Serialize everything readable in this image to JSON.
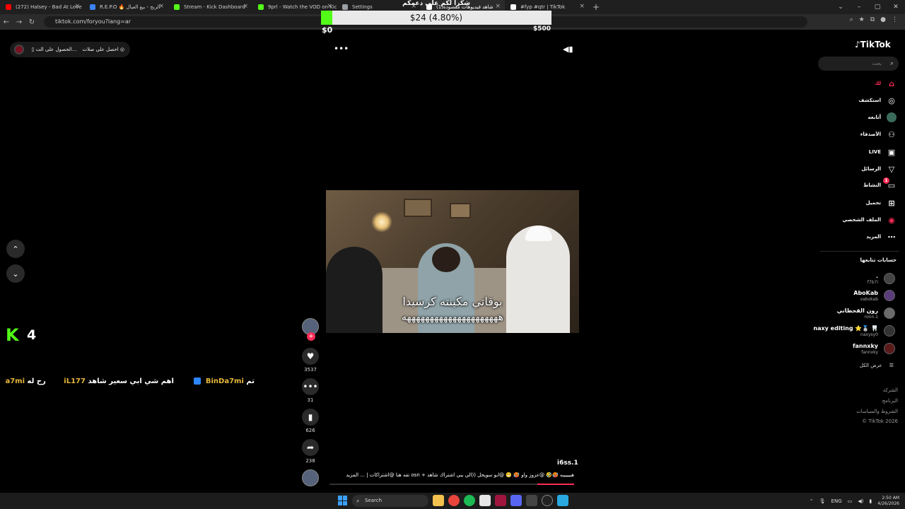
{
  "browser": {
    "tabs": [
      {
        "title": "(272) Halsey - Bad At Love",
        "favicon_color": "#ff0000"
      },
      {
        "title": "R.E.P.O 🔥 الربح - بيع العيال",
        "favicon_color": "#3b82f6"
      },
      {
        "title": "Stream - Kick Dashboard",
        "favicon_color": "#53fc18"
      },
      {
        "title": "9prl - Watch the VOD on Kick",
        "favicon_color": "#53fc18"
      },
      {
        "title": "Settings",
        "favicon_color": "#9aa0a6"
      },
      {
        "title": "(1)شاهد فيديوهات مقصودة",
        "favicon_color": "#ffffff"
      },
      {
        "title": "#fyp #qtr | TikTok",
        "favicon_color": "#ffffff"
      }
    ],
    "active_tab_index": 5,
    "url": "tiktok.com/foryou?lang=ar"
  },
  "donation": {
    "header": "شكرا لكم على دعمكم",
    "amount_text": "$24 (4.80%)",
    "progress_fraction": 0.048,
    "min_label": "$0",
    "max_label": "$500",
    "fill_color": "#53fc18"
  },
  "promo": {
    "item1": "احصل على صلات",
    "item2": "الحصول على الت..."
  },
  "video": {
    "subtitle_line1": "بوقاتي مكينته كرسيدا",
    "subtitle_line2": "هههههههههههههههههههههه"
  },
  "actions": {
    "likes": "3537",
    "comments": "31",
    "bookmarks": "626",
    "shares": "238"
  },
  "post": {
    "username": "i6ss.1",
    "caption": "هييييييه 🥵🤣 @عزوز واو 🥵 😬 @ابو سويحل ((الي يبي اشتراك شاهد + osn تفه هنا @اشتراكات | ... المزيد",
    "progress_fraction": 0.15
  },
  "kick_overlay": {
    "viewer_count": "4",
    "ticker": [
      {
        "gold": "BinDa7mi",
        "white": "تم"
      },
      {
        "gold": "iL177",
        "white": "اهم شي ابي سعير شاهد"
      },
      {
        "gold": "a7mi",
        "white": "رح له"
      }
    ]
  },
  "sidebar": {
    "logo": "TikTok",
    "search_placeholder": "بحث",
    "items": [
      {
        "label": "لك",
        "icon": "home-icon",
        "active": true
      },
      {
        "label": "استكشف",
        "icon": "compass-icon",
        "active": false
      },
      {
        "label": "أتابعه",
        "icon": "following-avatar-icon",
        "active": false
      },
      {
        "label": "الأصدقاء",
        "icon": "friends-icon",
        "active": false
      },
      {
        "label": "LIVE",
        "icon": "live-icon",
        "active": false
      },
      {
        "label": "الرسائل",
        "icon": "messages-icon",
        "active": false
      },
      {
        "label": "النشاط",
        "icon": "activity-icon",
        "active": false,
        "badge": "1"
      },
      {
        "label": "تحميل",
        "icon": "upload-icon",
        "active": false
      },
      {
        "label": "الملف الشخصي",
        "icon": "profile-icon",
        "active": false
      },
      {
        "label": "المزيد",
        "icon": "more-icon",
        "active": false
      }
    ],
    "following_title": "حسابات تتابعها",
    "following": [
      {
        "name": ".",
        "handle": "f7b7i"
      },
      {
        "name": "AboKab",
        "handle": "vabokab"
      },
      {
        "name": "رون القحطاني",
        "handle": "ronn.1"
      },
      {
        "name": "naxy editing ⭐🥈 🦷",
        "handle": "naxysy0"
      },
      {
        "name": "fannxky",
        "handle": "fannxky"
      }
    ],
    "show_all": "عرض الكل",
    "footer": [
      "الشركة",
      "البرنامج",
      "الشروط والسياسات",
      "© TikTok 2026"
    ]
  },
  "taskbar": {
    "search_label": "Search",
    "lang": "ENG",
    "time": "2:50 AM",
    "date": "4/26/2026"
  }
}
